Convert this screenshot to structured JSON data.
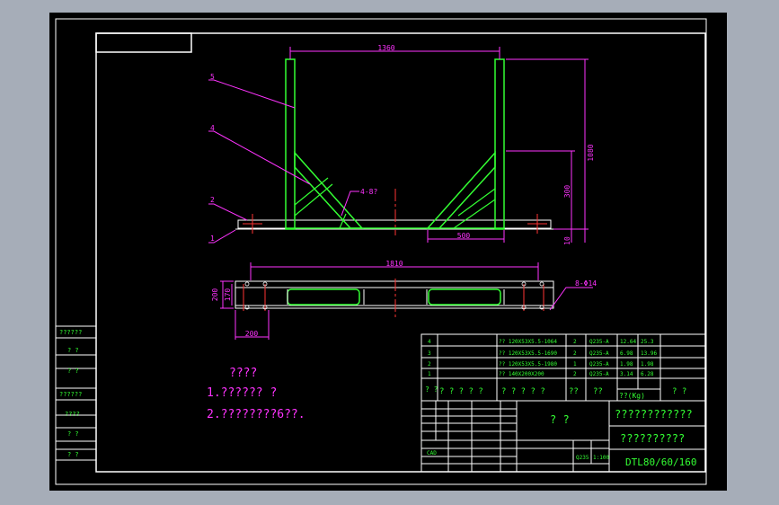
{
  "viewer": {
    "background_color": "#a6adb8",
    "sheet_color": "#000000"
  },
  "dimensions": {
    "top_width": "1360",
    "height_total": "1080",
    "height_mid": "300",
    "height_base": "10",
    "base_span": "500",
    "weld": "4-8?",
    "bottom_width": "1810",
    "depth_outer": "200",
    "depth_inner": "170",
    "bottom_offset": "200",
    "holes": "8-Φ14"
  },
  "balloons": [
    "5",
    "4",
    "2",
    "1"
  ],
  "notes": {
    "title": "????",
    "line1": "1.?????? ?",
    "line2": "2.????????6??."
  },
  "left_stamp_rows": [
    "??????",
    "?   ?",
    "?   ?",
    "??????",
    "????",
    "?   ?",
    "?   ?",
    "?   ?"
  ],
  "bom": {
    "rows": [
      {
        "no": "4",
        "spec": "?? 120X53X5.5-1064",
        "qty": "2",
        "material": "Q235-A",
        "unit": "12.64",
        "total": "25.3"
      },
      {
        "no": "3",
        "spec": "?? 120X53X5.5-1690",
        "qty": "2",
        "material": "Q235-A",
        "unit": "6.98",
        "total": "13.96"
      },
      {
        "no": "2",
        "spec": "?? 120X53X5.5-1980",
        "qty": "1",
        "material": "Q235-A",
        "unit": "1.98",
        "total": "1.98"
      },
      {
        "no": "1",
        "spec": "?? 140X200X200",
        "qty": "2",
        "material": "Q235-A",
        "unit": "3.14",
        "total": "6.28"
      }
    ],
    "header": {
      "no": "? ?",
      "code": "? ? ? ? ?",
      "name": "? ? ? ? ?",
      "qty": "??",
      "material": "??",
      "weight": "??(Kg)",
      "note": "? ?"
    }
  },
  "title_block": {
    "part_name": "?  ?",
    "drawing_title": "????????????",
    "company": "??????????",
    "scale": "1:100",
    "material": "Q235",
    "drawing_no": "DTL80/60/160",
    "cad": "CAD"
  }
}
